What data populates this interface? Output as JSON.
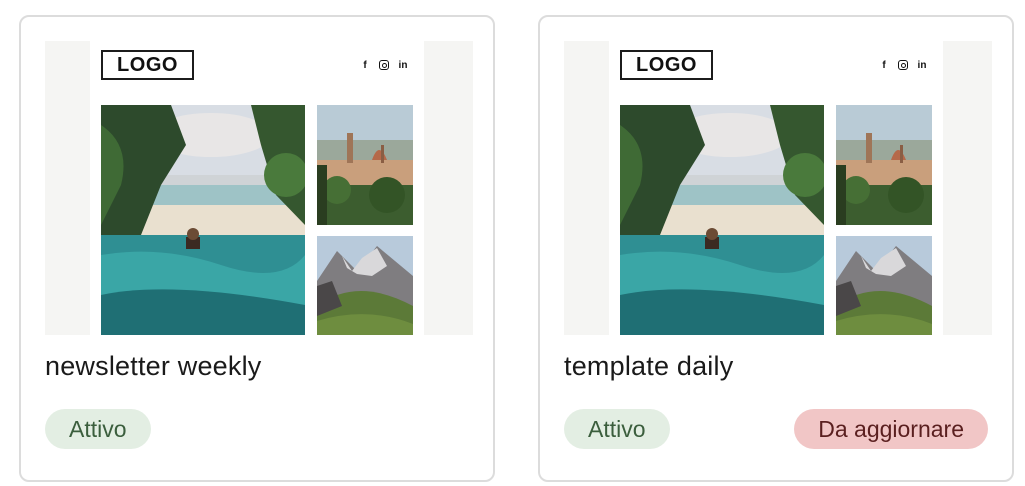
{
  "cards": [
    {
      "title": "newsletter weekly",
      "preview": {
        "logo_text": "LOGO",
        "social_icons": [
          "facebook-icon",
          "instagram-icon",
          "linkedin-icon"
        ]
      },
      "badges": [
        {
          "label": "Attivo",
          "kind": "status-active"
        }
      ]
    },
    {
      "title": "template daily",
      "preview": {
        "logo_text": "LOGO",
        "social_icons": [
          "facebook-icon",
          "instagram-icon",
          "linkedin-icon"
        ]
      },
      "badges": [
        {
          "label": "Attivo",
          "kind": "status-active"
        },
        {
          "label": "Da aggiornare",
          "kind": "status-outdated"
        }
      ]
    }
  ],
  "social_glyphs": {
    "facebook": "f",
    "linkedin": "in"
  },
  "colors": {
    "active_bg": "#e3eee3",
    "active_text": "#3b5e3d",
    "outdated_bg": "#f1c6c6",
    "outdated_text": "#5a1f1f",
    "card_border": "#dcdcdc"
  }
}
